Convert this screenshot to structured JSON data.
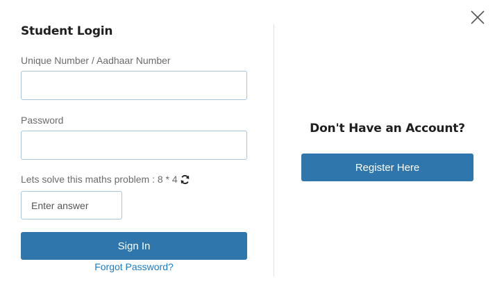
{
  "login": {
    "title": "Student Login",
    "uid_label": "Unique Number / Aadhaar Number",
    "uid_value": "",
    "password_label": "Password",
    "password_value": "",
    "captcha_label": "Lets solve this maths problem : 8 * 4",
    "answer_placeholder": "Enter answer",
    "answer_value": "",
    "signin_label": "Sign In",
    "forgot_label": "Forgot Password?"
  },
  "register": {
    "heading": "Don't Have an Account?",
    "button_label": "Register Here"
  },
  "icons": {
    "close": "close-icon",
    "refresh": "refresh-icon"
  },
  "colors": {
    "primary": "#2e76ab",
    "link": "#1a7bc8",
    "input_border": "#a9c4dc"
  }
}
